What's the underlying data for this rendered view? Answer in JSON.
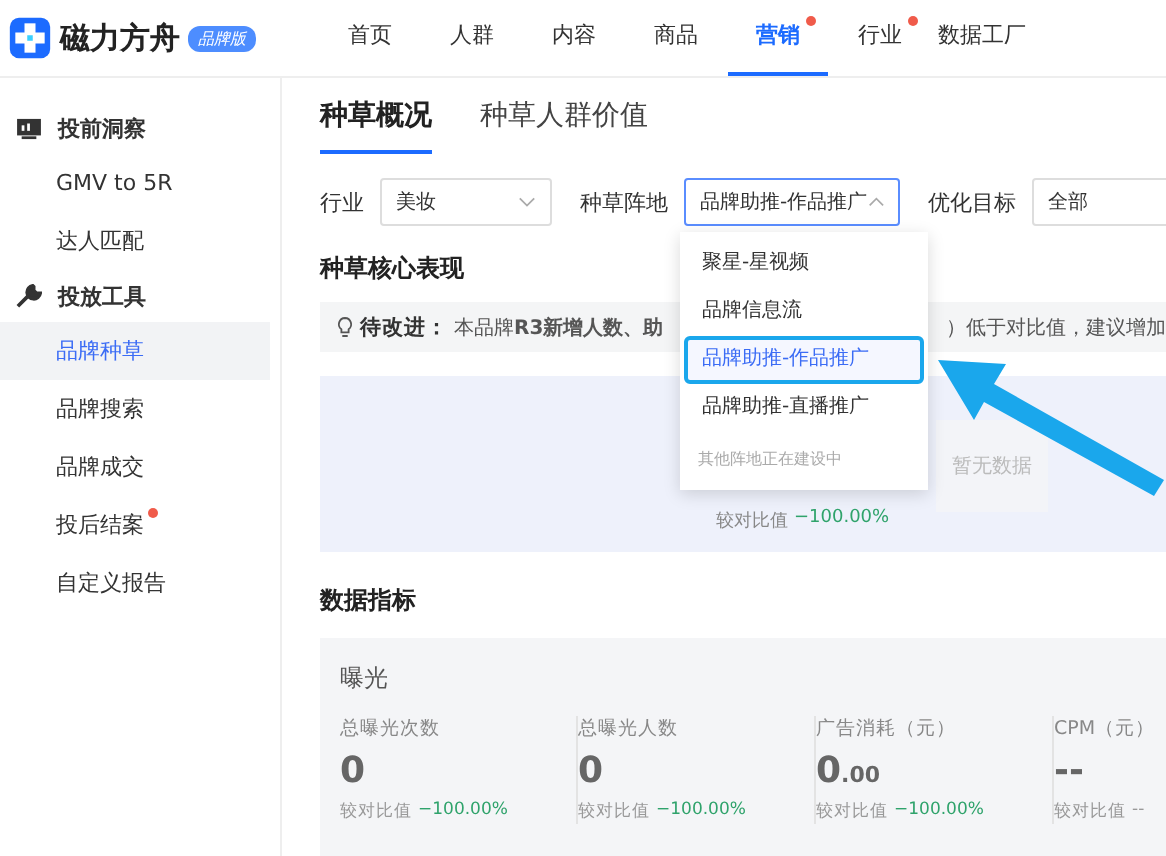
{
  "brand": {
    "name": "磁力方舟",
    "badge": "品牌版"
  },
  "nav": [
    {
      "label": "首页",
      "selected": false,
      "dot": false
    },
    {
      "label": "人群",
      "selected": false,
      "dot": false
    },
    {
      "label": "内容",
      "selected": false,
      "dot": false
    },
    {
      "label": "商品",
      "selected": false,
      "dot": false
    },
    {
      "label": "营销",
      "selected": true,
      "dot": true
    },
    {
      "label": "行业",
      "selected": false,
      "dot": true
    },
    {
      "label": "数据工厂",
      "selected": false,
      "dot": false
    }
  ],
  "sidebar": [
    {
      "label": "投前洞察",
      "children": [
        {
          "label": "GMV to 5R",
          "selected": false,
          "dot": false
        },
        {
          "label": "达人匹配",
          "selected": false,
          "dot": false
        }
      ]
    },
    {
      "label": "投放工具",
      "children": [
        {
          "label": "品牌种草",
          "selected": true,
          "dot": false
        },
        {
          "label": "品牌搜索",
          "selected": false,
          "dot": false
        },
        {
          "label": "品牌成交",
          "selected": false,
          "dot": false
        },
        {
          "label": "投后结案",
          "selected": false,
          "dot": true
        },
        {
          "label": "自定义报告",
          "selected": false,
          "dot": false
        }
      ]
    }
  ],
  "tabs": [
    {
      "label": "种草概况",
      "selected": true
    },
    {
      "label": "种草人群价值",
      "selected": false
    }
  ],
  "filters": [
    {
      "label": "行业",
      "value": "美妆",
      "open": false
    },
    {
      "label": "种草阵地",
      "value": "品牌助推-作品推广",
      "open": true
    },
    {
      "label": "优化目标",
      "value": "全部",
      "open": false
    }
  ],
  "dropdown": {
    "options": [
      {
        "label": "聚星-星视频",
        "selected": false
      },
      {
        "label": "品牌信息流",
        "selected": false
      },
      {
        "label": "品牌助推-作品推广",
        "selected": true
      },
      {
        "label": "品牌助推-直播推广",
        "selected": false
      }
    ],
    "note": "其他阵地正在建设中"
  },
  "core": {
    "title": "种草核心表现",
    "tip_label": "待改进：",
    "tip_start": "本品牌**R3新增人数、助**",
    "tip_end": "）低于对比值，建议增加",
    "empty": "暂无数据",
    "compare_label": "较对比值",
    "compare_value": "−100.00%"
  },
  "metrics": {
    "title": "数据指标",
    "group": "曝光",
    "items": [
      {
        "label": "总曝光次数",
        "value": "0",
        "compare_label": "较对比值",
        "compare_value": "−100.00%",
        "color": "#2fa36b"
      },
      {
        "label": "总曝光人数",
        "value": "0",
        "compare_label": "较对比值",
        "compare_value": "−100.00%",
        "color": "#2fa36b"
      },
      {
        "label": "广告消耗（元）",
        "value": "0",
        "fraction": ".00",
        "compare_label": "较对比值",
        "compare_value": "−100.00%",
        "color": "#2fa36b"
      },
      {
        "label": "CPM（元）",
        "value": "--",
        "compare_label": "较对比值",
        "compare_value": "--",
        "color": "#999999"
      }
    ]
  }
}
